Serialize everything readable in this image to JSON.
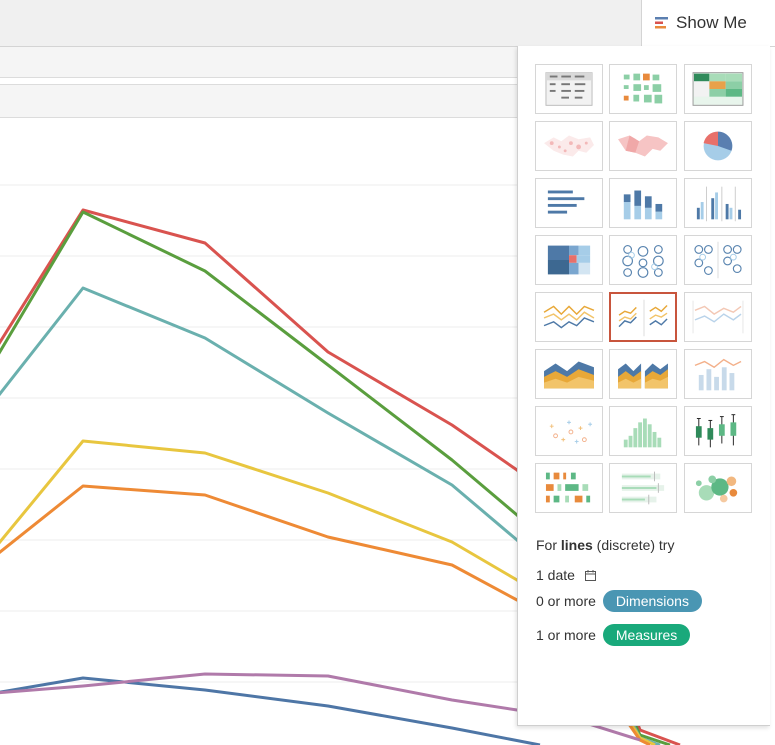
{
  "tab": {
    "label": "Show Me"
  },
  "colors": {
    "lines": [
      "#d9534f",
      "#5a9e3e",
      "#6ab0ae",
      "#e8c63f",
      "#ee8a35",
      "#4e76a6",
      "#b07aaa"
    ],
    "dimensions_pill": "#4a96b3",
    "measures_pill": "#19a97b",
    "selected_border": "#c8553d"
  },
  "show_me": {
    "chart_types": [
      {
        "icon": "text-table-icon",
        "selected": false
      },
      {
        "icon": "heat-map-icon",
        "selected": false
      },
      {
        "icon": "highlight-table-icon",
        "selected": false
      },
      {
        "icon": "symbol-map-icon",
        "selected": false
      },
      {
        "icon": "filled-map-icon",
        "selected": false
      },
      {
        "icon": "pie-chart-icon",
        "selected": false
      },
      {
        "icon": "horizontal-bars-icon",
        "selected": false
      },
      {
        "icon": "stacked-bars-icon",
        "selected": false
      },
      {
        "icon": "side-by-side-bars-icon",
        "selected": false
      },
      {
        "icon": "treemap-icon",
        "selected": false
      },
      {
        "icon": "circle-views-icon",
        "selected": false
      },
      {
        "icon": "side-by-side-circles-icon",
        "selected": false
      },
      {
        "icon": "lines-continuous-icon",
        "selected": false
      },
      {
        "icon": "lines-discrete-icon",
        "selected": true
      },
      {
        "icon": "dual-lines-icon",
        "selected": false
      },
      {
        "icon": "area-continuous-icon",
        "selected": false
      },
      {
        "icon": "area-discrete-icon",
        "selected": false
      },
      {
        "icon": "dual-combination-icon",
        "selected": false
      },
      {
        "icon": "scatter-plot-icon",
        "selected": false
      },
      {
        "icon": "histogram-icon",
        "selected": false
      },
      {
        "icon": "box-and-whisker-icon",
        "selected": false
      },
      {
        "icon": "gantt-chart-icon",
        "selected": false
      },
      {
        "icon": "bullet-graph-icon",
        "selected": false
      },
      {
        "icon": "packed-bubbles-icon",
        "selected": false
      }
    ],
    "hint": {
      "prefix": "For ",
      "chart_name": "lines",
      "suffix": " (discrete) try",
      "req1": "1 date",
      "req2_prefix": "0 or more",
      "req2_pill": "Dimensions",
      "req3_prefix": "1 or more",
      "req3_pill": "Measures"
    }
  }
}
